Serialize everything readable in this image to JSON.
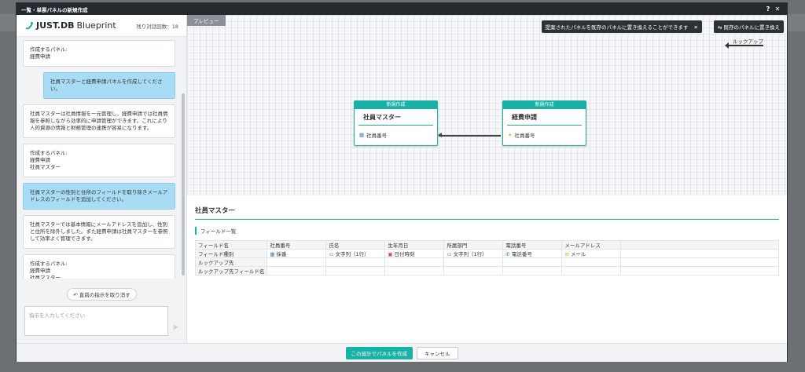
{
  "window": {
    "title": "一覧・単票パネルの新規作成",
    "help": "?",
    "close": "✕"
  },
  "left": {
    "logo_main": "JUST.DB",
    "logo_sub": "Blueprint",
    "remaining": "残り対話回数：18",
    "messages": [
      {
        "role": "system",
        "lines": [
          "作成するパネル:",
          "経費申請"
        ]
      },
      {
        "role": "user",
        "lines": [
          "社員マスターと経費申請パネルを作成してください。"
        ]
      },
      {
        "role": "system",
        "lines": [
          "社員マスターは社員情報を一元管理し、経費申請では社員情",
          "報を参照しながら効率的に申請管理ができます。これにより",
          "人的資源の情報と財務管理の連携が容易になります。"
        ]
      },
      {
        "role": "system",
        "lines": [
          "作成するパネル:",
          "経費申請",
          "社員マスター"
        ]
      },
      {
        "role": "user",
        "lines": [
          "社員マスターの性別と住所のフィールドを取り除きメールア",
          "ドレスのフィールドを追加してください。"
        ]
      },
      {
        "role": "system",
        "lines": [
          "社員マスターでは基本情報にメールアドレスを追加し、性別",
          "と住所を除外しました。また経費申請は社員マスターを参照",
          "して効率よく管理できます。"
        ]
      },
      {
        "role": "system",
        "lines": [
          "作成するパネル:",
          "経費申請",
          "社員マスター"
        ]
      }
    ],
    "undo_label": "直前の指示を取り消す",
    "input_placeholder": "指示を入力してください"
  },
  "preview": {
    "tag": "プレビュー",
    "replace_note": "提案されたパネルを既存のパネルに置き換えることができます",
    "replace_button": "既存のパネルに置き換え",
    "lookup_label": "ルックアップ",
    "cards": [
      {
        "badge": "新規作成",
        "name": "社員マスター",
        "field": "社員番号",
        "icon": "id-card-icon"
      },
      {
        "badge": "新規作成",
        "name": "経費申請",
        "field": "社員番号",
        "icon": "lookup-icon"
      }
    ]
  },
  "details": {
    "title": "社員マスター",
    "field_list_label": "フィールド一覧",
    "columns": [
      "フィールド名",
      "社員番号",
      "氏名",
      "生年月日",
      "所属部門",
      "電話番号",
      "メールアドレス",
      ""
    ],
    "rows": [
      {
        "label": "フィールド種別",
        "cells": [
          "採番",
          "文字列（1行）",
          "日付時刻",
          "文字列（1行）",
          "電話番号",
          "メール",
          ""
        ]
      },
      {
        "label": "ルックアップ先",
        "cells": [
          "",
          "",
          "",
          "",
          "",
          "",
          ""
        ]
      },
      {
        "label": "ルックアップ先フィールド名",
        "cells": [
          "",
          "",
          "",
          "",
          "",
          "",
          ""
        ]
      }
    ]
  },
  "footer": {
    "create": "この設計でパネルを作成",
    "cancel": "キャンセル"
  },
  "colors": {
    "accent": "#19b0a5",
    "user_bubble": "#a8dcf5",
    "titlebar": "#24292d"
  }
}
